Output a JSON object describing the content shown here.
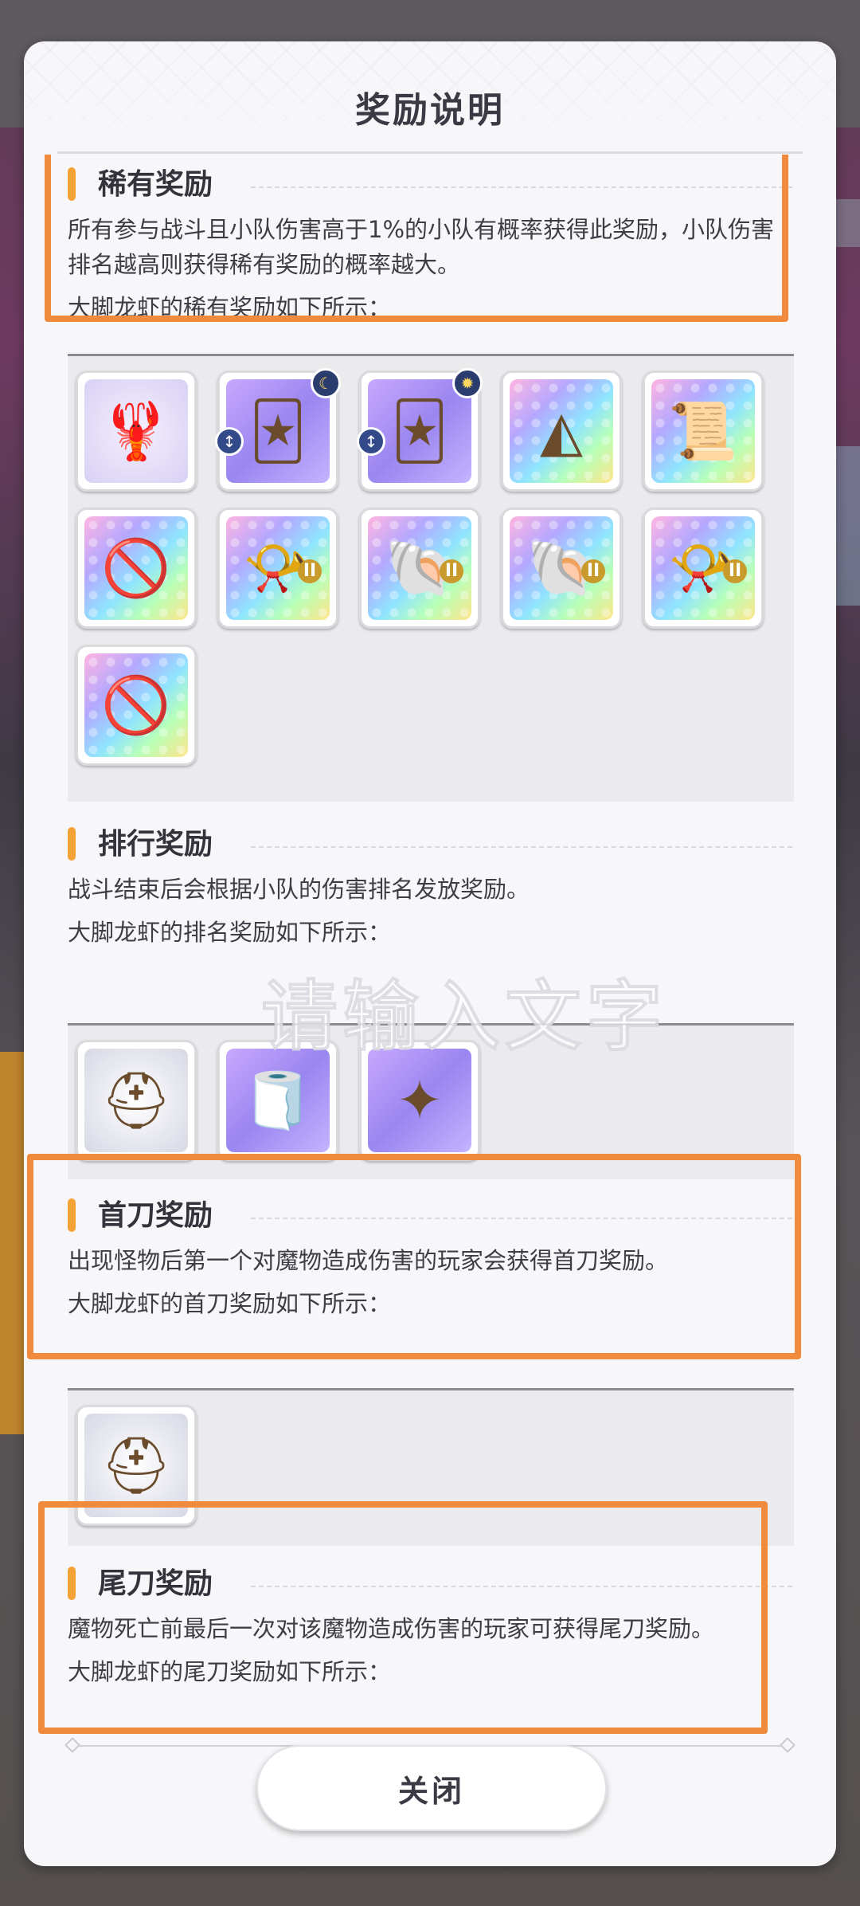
{
  "modal": {
    "title": "奖励说明",
    "close_label": "关闭"
  },
  "sections": {
    "rare": {
      "title": "稀有奖励",
      "text1": "所有参与战斗且小队伤害高于1%的小队有概率获得此奖励，小队伤害排名越高则获得稀有奖励的概率越大。",
      "text2": "大脚龙虾的稀有奖励如下所示："
    },
    "rank": {
      "title": "排行奖励",
      "text1": "战斗结束后会根据小队的伤害排名发放奖励。",
      "text2": "大脚龙虾的排名奖励如下所示："
    },
    "first": {
      "title": "首刀奖励",
      "text1": "出现怪物后第一个对魔物造成伤害的玩家会获得首刀奖励。",
      "text2": "大脚龙虾的首刀奖励如下所示："
    },
    "last": {
      "title": "尾刀奖励",
      "text1": "魔物死亡前最后一次对该魔物造成伤害的玩家可获得尾刀奖励。",
      "text2": "大脚龙虾的尾刀奖励如下所示："
    }
  },
  "watermark": "请输入文字",
  "icons": {
    "rare": [
      {
        "name": "lobster-portrait-icon",
        "glyph": "🦞",
        "style": "plain"
      },
      {
        "name": "character-card-icon",
        "glyph": "🃏",
        "style": "purple",
        "badge_tl": "↕",
        "badge_tr": "☾"
      },
      {
        "name": "character-card-icon",
        "glyph": "🃏",
        "style": "purple",
        "badge_tl": "↕",
        "badge_tr": "✹"
      },
      {
        "name": "crystal-triangle-icon",
        "glyph": "◭",
        "style": "rainbow"
      },
      {
        "name": "scroll-map-icon",
        "glyph": "📜",
        "style": "rainbow"
      },
      {
        "name": "forbidden-item-icon",
        "glyph": "🚫",
        "style": "rainbow"
      },
      {
        "name": "horn-item-icon",
        "glyph": "📯",
        "style": "rainbow",
        "roman": "II"
      },
      {
        "name": "conch-shell-icon",
        "glyph": "🐚",
        "style": "rainbow",
        "roman": "II"
      },
      {
        "name": "conch-shell-icon",
        "glyph": "🐚",
        "style": "rainbow",
        "roman": "II"
      },
      {
        "name": "horn-item-icon",
        "glyph": "📯",
        "style": "rainbow",
        "roman": "II"
      },
      {
        "name": "forbidden-item-icon",
        "glyph": "🚫",
        "style": "rainbow"
      }
    ],
    "rank": [
      {
        "name": "helmet-medal-icon",
        "glyph": "⛑",
        "style": "silver"
      },
      {
        "name": "gold-reel-icon",
        "glyph": "🧻",
        "style": "purple"
      },
      {
        "name": "star-badge-icon",
        "glyph": "✦",
        "style": "purple"
      }
    ],
    "first": [
      {
        "name": "helmet-medal-icon",
        "glyph": "⛑",
        "style": "silver"
      }
    ]
  },
  "colors": {
    "accent_bar": "#f4a233",
    "highlight": "#f08a3c"
  }
}
